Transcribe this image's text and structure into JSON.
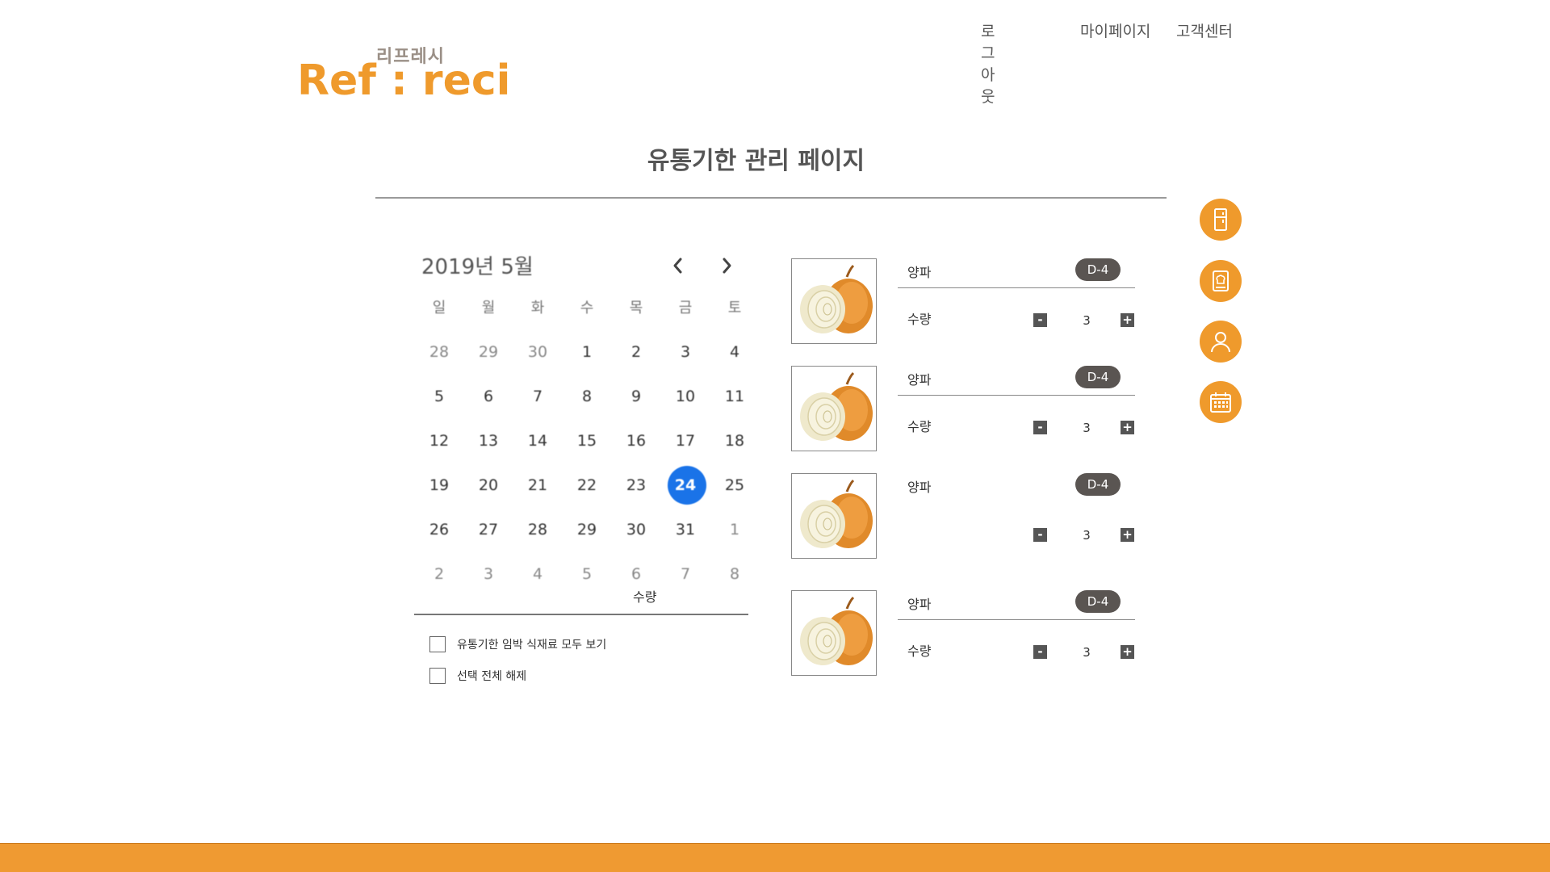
{
  "header": {
    "nav": {
      "logout": "로그아웃",
      "mypage": "마이페이지",
      "support": "고객센터"
    },
    "logo": {
      "sub": "리프레시",
      "main": "Ref : reci"
    }
  },
  "page": {
    "title": "유통기한 관리 페이지"
  },
  "calendar": {
    "month_label": "2019년 5월",
    "weekdays": [
      "일",
      "월",
      "화",
      "수",
      "목",
      "금",
      "토"
    ],
    "weeks": [
      [
        {
          "d": "28",
          "m": true
        },
        {
          "d": "29",
          "m": true
        },
        {
          "d": "30",
          "m": true
        },
        {
          "d": "1"
        },
        {
          "d": "2"
        },
        {
          "d": "3"
        },
        {
          "d": "4"
        }
      ],
      [
        {
          "d": "5"
        },
        {
          "d": "6"
        },
        {
          "d": "7"
        },
        {
          "d": "8"
        },
        {
          "d": "9"
        },
        {
          "d": "10"
        },
        {
          "d": "11"
        }
      ],
      [
        {
          "d": "12"
        },
        {
          "d": "13"
        },
        {
          "d": "14"
        },
        {
          "d": "15"
        },
        {
          "d": "16"
        },
        {
          "d": "17"
        },
        {
          "d": "18"
        }
      ],
      [
        {
          "d": "19"
        },
        {
          "d": "20"
        },
        {
          "d": "21"
        },
        {
          "d": "22"
        },
        {
          "d": "23"
        },
        {
          "d": "24",
          "sel": true
        },
        {
          "d": "25"
        }
      ],
      [
        {
          "d": "26"
        },
        {
          "d": "27"
        },
        {
          "d": "28"
        },
        {
          "d": "29"
        },
        {
          "d": "30"
        },
        {
          "d": "31"
        },
        {
          "d": "1",
          "m": true
        }
      ],
      [
        {
          "d": "2",
          "m": true
        },
        {
          "d": "3",
          "m": true
        },
        {
          "d": "4",
          "m": true
        },
        {
          "d": "5",
          "m": true
        },
        {
          "d": "6",
          "m": true
        },
        {
          "d": "7",
          "m": true
        },
        {
          "d": "8",
          "m": true
        }
      ]
    ],
    "overlay_label": "수량",
    "accent_color": "#1a73e8"
  },
  "options": {
    "show_expiring": "유통기한 임박 식재료 모두 보기",
    "clear_all": "선택 전체 해제"
  },
  "items": [
    {
      "name": "양파",
      "badge": "D-4",
      "qty_label": "수량",
      "qty": "3"
    },
    {
      "name": "양파",
      "badge": "D-4",
      "qty_label": "수량",
      "qty": "3"
    },
    {
      "name": "양파",
      "badge": "D-4",
      "qty_label": "",
      "qty": "3"
    },
    {
      "name": "양파",
      "badge": "D-4",
      "qty_label": "수량",
      "qty": "3"
    }
  ],
  "side_icons": [
    "fridge-icon",
    "recipe-book-icon",
    "user-icon",
    "calendar-icon"
  ],
  "colors": {
    "brand": "#ef9a2c",
    "badge": "#5a5552"
  }
}
